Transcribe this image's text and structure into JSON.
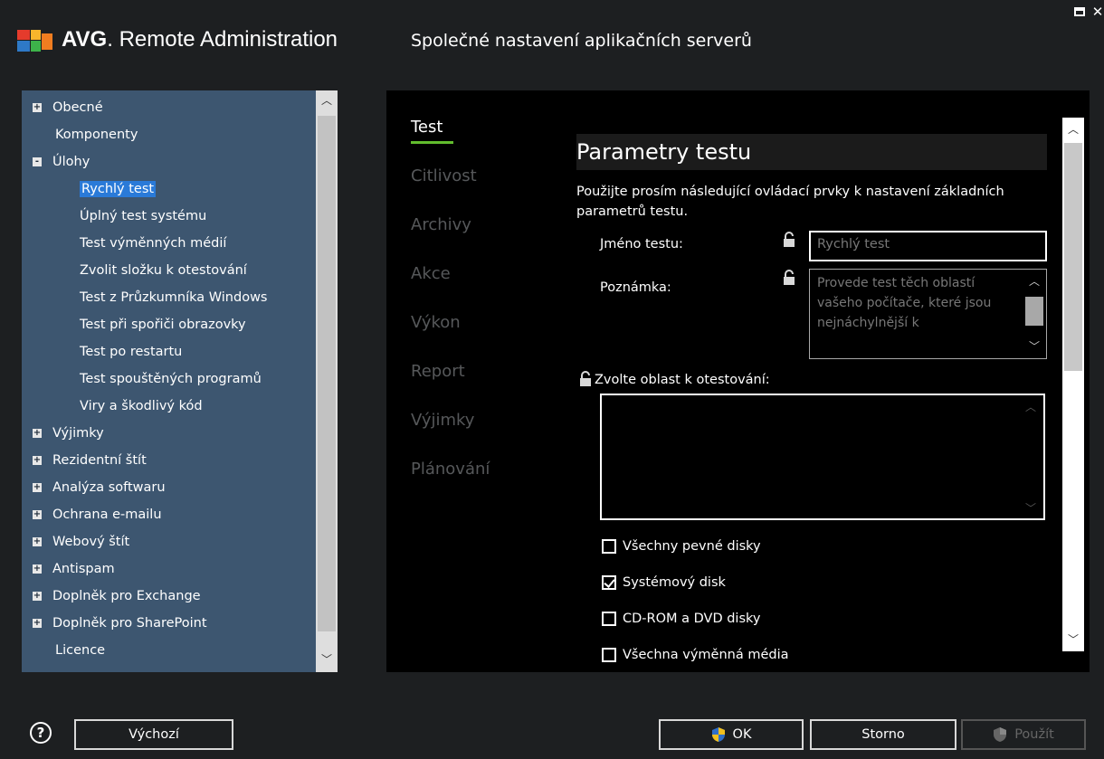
{
  "app": {
    "brand_bold": "AVG",
    "brand_rest": "Remote Administration",
    "window_title": "Společné nastavení aplikačních serverů"
  },
  "tree": {
    "items": [
      {
        "label": "Obecné",
        "expander": "+"
      },
      {
        "label": "Komponenty",
        "expander": ""
      },
      {
        "label": "Úlohy",
        "expander": "-"
      },
      {
        "label": "Rychlý test",
        "expander": "",
        "selected": true
      },
      {
        "label": "Úplný test systému",
        "expander": ""
      },
      {
        "label": "Test výměnných médií",
        "expander": ""
      },
      {
        "label": "Zvolit složku k otestování",
        "expander": ""
      },
      {
        "label": "Test z Průzkumníka Windows",
        "expander": ""
      },
      {
        "label": "Test při spořiči obrazovky",
        "expander": ""
      },
      {
        "label": "Test po restartu",
        "expander": ""
      },
      {
        "label": "Test spouštěných programů",
        "expander": ""
      },
      {
        "label": "Viry a škodlivý kód",
        "expander": ""
      },
      {
        "label": "Výjimky",
        "expander": "+"
      },
      {
        "label": "Rezidentní štít",
        "expander": "+"
      },
      {
        "label": "Analýza softwaru",
        "expander": "+"
      },
      {
        "label": "Ochrana e-mailu",
        "expander": "+"
      },
      {
        "label": "Webový štít",
        "expander": "+"
      },
      {
        "label": "Antispam",
        "expander": "+"
      },
      {
        "label": "Doplněk pro Exchange",
        "expander": "+"
      },
      {
        "label": "Doplněk pro SharePoint",
        "expander": "+"
      },
      {
        "label": "Licence",
        "expander": ""
      }
    ]
  },
  "tabs": [
    "Test",
    "Citlivost",
    "Archivy",
    "Akce",
    "Výkon",
    "Report",
    "Výjimky",
    "Plánování"
  ],
  "active_tab": "Test",
  "section": {
    "heading": "Parametry testu",
    "description": "Použijte prosím následující ovládací prvky k nastavení základních parametrů testu.",
    "name_label": "Jméno testu:",
    "name_value": "Rychlý test",
    "note_label": "Poznámka:",
    "note_value": "Provede test těch oblastí vašeho počítače, které jsou nejnáchylnější k",
    "area_label": "Zvolte oblast k otestování:",
    "checks": [
      {
        "label": "Všechny pevné disky",
        "checked": false
      },
      {
        "label": "Systémový disk",
        "checked": true
      },
      {
        "label": "CD-ROM a DVD disky",
        "checked": false
      },
      {
        "label": "Všechna výměnná média",
        "checked": false
      }
    ]
  },
  "footer": {
    "help": "?",
    "default_btn": "Výchozí",
    "ok_btn": "OK",
    "cancel_btn": "Storno",
    "apply_btn": "Použít"
  },
  "colors": {
    "tree_bg": "#3d5670",
    "selection": "#2a7ad8",
    "tab_accent": "#62bd2e",
    "window_bg": "#1d1f21"
  }
}
